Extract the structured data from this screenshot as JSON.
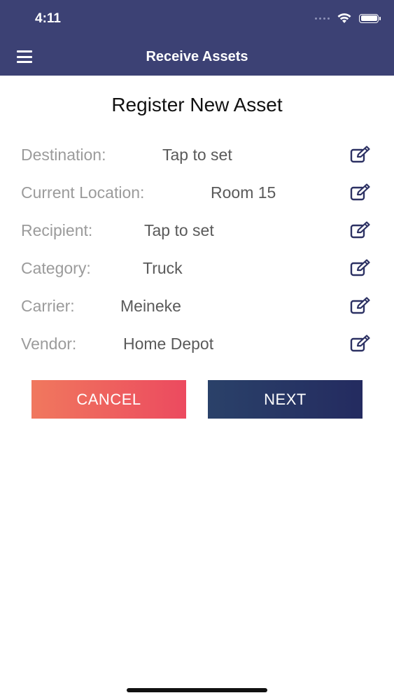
{
  "status_bar": {
    "time": "4:11"
  },
  "nav": {
    "title": "Receive Assets",
    "menu_icon": "hamburger-icon"
  },
  "page": {
    "title": "Register New Asset"
  },
  "form": {
    "rows": [
      {
        "label": "Destination:",
        "value": "Tap to set"
      },
      {
        "label": "Current Location:",
        "value": "Room 15"
      },
      {
        "label": "Recipient:",
        "value": "Tap to set"
      },
      {
        "label": "Category:",
        "value": "Truck"
      },
      {
        "label": "Carrier:",
        "value": "Meineke"
      },
      {
        "label": "Vendor:",
        "value": "Home Depot"
      }
    ],
    "edit_icon": "edit-icon"
  },
  "buttons": {
    "cancel": "CANCEL",
    "next": "NEXT"
  },
  "colors": {
    "header": "#3c4174",
    "cancel_start": "#f0785e",
    "cancel_end": "#ec4a5f",
    "next_start": "#2a4169",
    "next_end": "#242b60",
    "icon": "#2c3163"
  }
}
